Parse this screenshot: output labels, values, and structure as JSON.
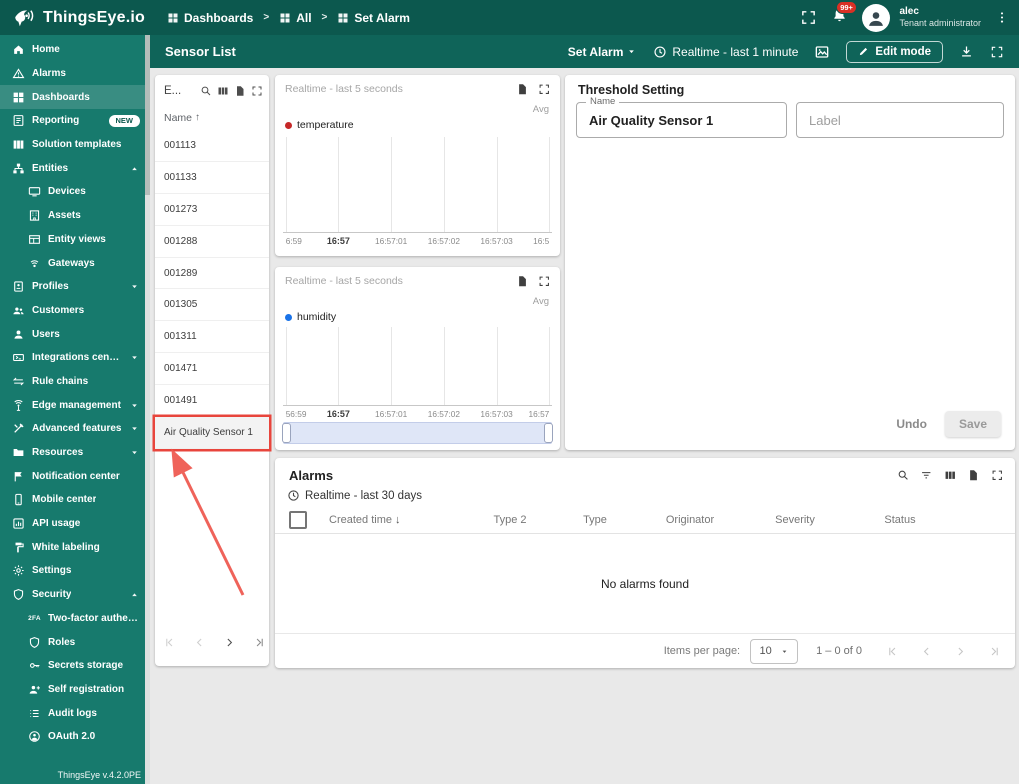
{
  "colors": {
    "header": "#0c584e",
    "subheader": "#0f6459",
    "sidebar": "#177a6d",
    "annotation_red": "#e8453c",
    "temperature": "#c62828",
    "humidity": "#1a73e8"
  },
  "topbar": {
    "logo": "ThingsEye.io",
    "breadcrumbs": [
      "Dashboards",
      "All",
      "Set Alarm"
    ],
    "notifications_badge": "99+",
    "user": {
      "name": "alec",
      "role": "Tenant administrator"
    }
  },
  "sidebar": {
    "footer": "ThingsEye v.4.2.0PE",
    "items": [
      {
        "label": "Home",
        "icon": "home"
      },
      {
        "label": "Alarms",
        "icon": "warning"
      },
      {
        "label": "Dashboards",
        "icon": "dashboards",
        "active": true
      },
      {
        "label": "Reporting",
        "icon": "report",
        "badge": "NEW"
      },
      {
        "label": "Solution templates",
        "icon": "columns3"
      },
      {
        "label": "Entities",
        "icon": "hierarchy",
        "expand": "up"
      },
      {
        "label": "Devices",
        "icon": "device",
        "child": true
      },
      {
        "label": "Assets",
        "icon": "building",
        "child": true
      },
      {
        "label": "Entity views",
        "icon": "entityview",
        "child": true
      },
      {
        "label": "Gateways",
        "icon": "gateway",
        "child": true
      },
      {
        "label": "Profiles",
        "icon": "profiles",
        "expand": "down"
      },
      {
        "label": "Customers",
        "icon": "people"
      },
      {
        "label": "Users",
        "icon": "person"
      },
      {
        "label": "Integrations center",
        "icon": "integration",
        "expand": "down"
      },
      {
        "label": "Rule chains",
        "icon": "swap"
      },
      {
        "label": "Edge management",
        "icon": "antenna",
        "expand": "down"
      },
      {
        "label": "Advanced features",
        "icon": "tools",
        "expand": "down"
      },
      {
        "label": "Resources",
        "icon": "folder",
        "expand": "down"
      },
      {
        "label": "Notification center",
        "icon": "flag"
      },
      {
        "label": "Mobile center",
        "icon": "phone"
      },
      {
        "label": "API usage",
        "icon": "apichart"
      },
      {
        "label": "White labeling",
        "icon": "brush"
      },
      {
        "label": "Settings",
        "icon": "gear"
      },
      {
        "label": "Security",
        "icon": "shield",
        "expand": "up"
      },
      {
        "label": "Two-factor authenticati...",
        "icon": "twofa",
        "child": true
      },
      {
        "label": "Roles",
        "icon": "shield",
        "child": true
      },
      {
        "label": "Secrets storage",
        "icon": "key",
        "child": true
      },
      {
        "label": "Self registration",
        "icon": "personadd",
        "child": true
      },
      {
        "label": "Audit logs",
        "icon": "list",
        "child": true
      },
      {
        "label": "OAuth 2.0",
        "icon": "lockperson",
        "child": true
      }
    ]
  },
  "subheader": {
    "title": "Sensor List",
    "state_label": "Set Alarm",
    "timewindow": "Realtime - last 1 minute",
    "edit_mode": "Edit mode"
  },
  "entity_list": {
    "title": "E...",
    "name_column": "Name",
    "sort_indicator": "↑",
    "rows": [
      "001113",
      "001133",
      "001273",
      "001288",
      "001289",
      "001305",
      "001311",
      "001471",
      "001491",
      "Air Quality Sensor 1"
    ],
    "selected_row": "Air Quality Sensor 1"
  },
  "charts": [
    {
      "title": "Realtime - last 5 seconds",
      "avg_label": "Avg",
      "legend": "temperature",
      "color": "#c62828",
      "ticks": [
        "6:59",
        "16:57",
        "16:57:01",
        "16:57:02",
        "16:57:03",
        "16:5"
      ]
    },
    {
      "title": "Realtime - last 5 seconds",
      "avg_label": "Avg",
      "legend": "humidity",
      "color": "#1a73e8",
      "ticks": [
        "56:59",
        "16:57",
        "16:57:01",
        "16:57:02",
        "16:57:03",
        "16:57"
      ]
    }
  ],
  "chart_data": [
    {
      "type": "line",
      "title": "Realtime - last 5 seconds",
      "series": [
        {
          "name": "temperature",
          "values": []
        }
      ],
      "x_ticks": [
        "6:59",
        "16:57",
        "16:57:01",
        "16:57:02",
        "16:57:03",
        "16:5"
      ],
      "grid": "vertical",
      "legend_position": "top-left"
    },
    {
      "type": "line",
      "title": "Realtime - last 5 seconds",
      "series": [
        {
          "name": "humidity",
          "values": []
        }
      ],
      "x_ticks": [
        "56:59",
        "16:57",
        "16:57:01",
        "16:57:02",
        "16:57:03",
        "16:57"
      ],
      "grid": "vertical",
      "legend_position": "top-left"
    }
  ],
  "threshold": {
    "title": "Threshold Setting",
    "name_label": "Name",
    "name_value": "Air Quality Sensor 1",
    "label_placeholder": "Label",
    "undo": "Undo",
    "save": "Save"
  },
  "alarms": {
    "title": "Alarms",
    "timewindow": "Realtime - last 30 days",
    "columns": [
      {
        "label": "Created time",
        "sort": "down"
      },
      {
        "label": "Type 2"
      },
      {
        "label": "Type"
      },
      {
        "label": "Originator"
      },
      {
        "label": "Severity"
      },
      {
        "label": "Status"
      }
    ],
    "rows": [],
    "empty_text": "No alarms found",
    "pagination": {
      "items_per_page_label": "Items per page:",
      "page_size": "10",
      "range": "1 – 0 of 0"
    }
  }
}
